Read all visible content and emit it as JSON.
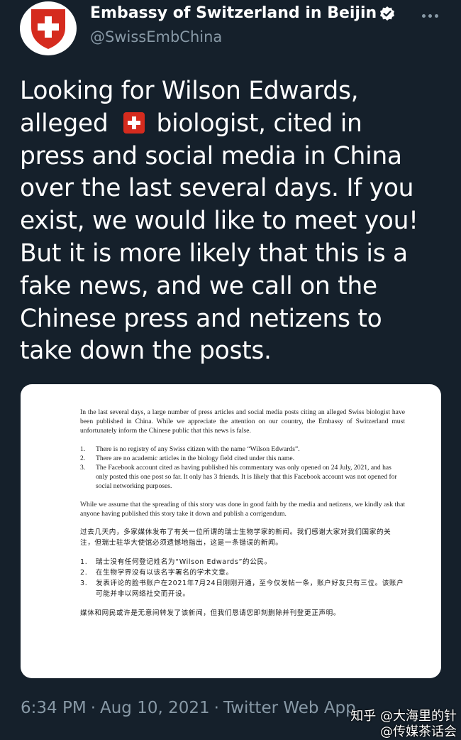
{
  "account": {
    "display_name": "Embassy of Switzerland in Beijin",
    "handle": "@SwissEmbChina",
    "verified": true,
    "avatar_icon": "swiss-cross-icon"
  },
  "menu_icon": "more-options-icon",
  "tweet": {
    "lines": [
      "Looking for Wilson Edwards,",
      "alleged",
      "biologist, cited in",
      "press and social media in China",
      "over the last several days. If you",
      "exist, we would like to meet you!",
      "But it is more likely that this is a",
      "fake news, and we call on the",
      "Chinese press and netizens to",
      "take down the posts."
    ],
    "emoji": "swiss-flag-emoji"
  },
  "statement": {
    "intro": "In the last several days, a large number of press articles and social media posts citing an alleged Swiss biologist have been published in China. While we appreciate the attention on our country, the Embassy of Switzerland must unfortunately inform the Chinese public that this news is false.",
    "items": [
      {
        "num": "1.",
        "text": "There is no registry of any Swiss citizen with the name “Wilson Edwards”."
      },
      {
        "num": "2.",
        "text": "There are no academic articles in the biology field cited under this name."
      },
      {
        "num": "3.",
        "text": "The Facebook account cited as having published his commentary was only opened on 24 July, 2021, and has only posted this one post so far. It only has 3 friends. It is likely that this Facebook account was not opened for social networking purposes."
      }
    ],
    "closing": "While we assume that the spreading of this story was done in good faith by the media and netizens, we kindly ask that anyone having published this story take it down and publish a corrigendum.",
    "intro_cn": "过去几天内，多家媒体发布了有关一位所谓的瑞士生物学家的新闻。我们感谢大家对我们国家的关注，但瑞士驻华大使馆必须遗憾地指出，这是一条错误的新闻。",
    "items_cn": [
      {
        "num": "1.",
        "text": "瑞士没有任何登记姓名为“Wilson Edwards”的公民。"
      },
      {
        "num": "2.",
        "text": "在生物学界没有以该名字署名的学术文章。"
      },
      {
        "num": "3.",
        "text": "发表评论的脸书账户在2021年7月24日刚刚开通，至今仅发帖一条，账户好友只有三位。该账户可能并非以网络社交而开设。"
      }
    ],
    "closing_cn": "媒体和网民或许是无意间转发了该新闻，但我们恳请您即刻删除并刊登更正声明。"
  },
  "meta": {
    "time": "6:34 PM",
    "separator": "·",
    "date": "Aug 10, 2021",
    "source": "Twitter Web App"
  },
  "watermark": {
    "line1": "知乎 @大海里的针",
    "line2": "@传媒茶话会"
  },
  "colors": {
    "background": "#15202b",
    "text": "#ffffff",
    "secondary": "#8899a6",
    "swiss_red": "#d52b1e"
  }
}
